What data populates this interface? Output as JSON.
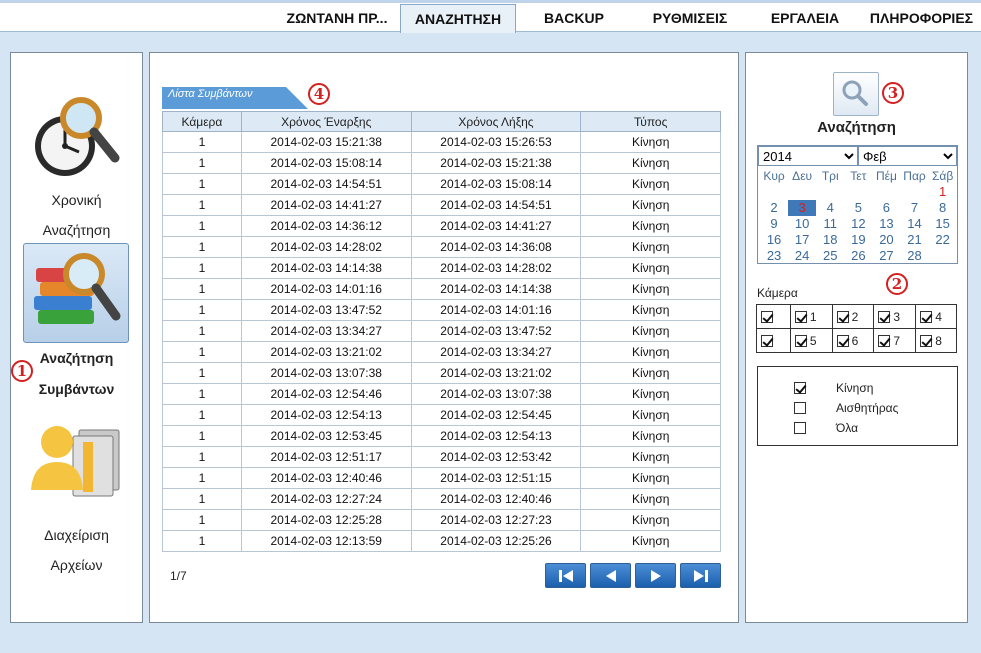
{
  "nav": {
    "tabs": [
      {
        "label": "ΖΩΝΤΑΝΗ ΠΡ...",
        "active": false
      },
      {
        "label": "ΑΝΑΖΗΤΗΣΗ",
        "active": true
      },
      {
        "label": "BACKUP",
        "active": false
      },
      {
        "label": "ΡΥΘΜΙΣΕΙΣ",
        "active": false
      },
      {
        "label": "ΕΡΓΑΛΕΙΑ",
        "active": false
      },
      {
        "label": "ΠΛΗΡΟΦΟΡΙΕΣ",
        "active": false
      }
    ]
  },
  "sidebar": {
    "items": [
      {
        "line1": "Χρονική",
        "line2": "Αναζήτηση",
        "icon": "clock-search-icon",
        "selected": false
      },
      {
        "line1": "Αναζήτηση",
        "line2": "Συμβάντων",
        "icon": "books-search-icon",
        "selected": true
      },
      {
        "line1": "Διαχείριση",
        "line2": "Αρχείων",
        "icon": "user-files-icon",
        "selected": false
      }
    ]
  },
  "markers": [
    "1",
    "2",
    "3",
    "4"
  ],
  "events": {
    "tab_label": "Λίστα Συμβάντων",
    "columns": [
      "Κάμερα",
      "Χρόνος Έναρξης",
      "Χρόνος Λήξης",
      "Τύπος"
    ],
    "rows": [
      [
        "1",
        "2014-02-03 15:21:38",
        "2014-02-03 15:26:53",
        "Κίνηση"
      ],
      [
        "1",
        "2014-02-03 15:08:14",
        "2014-02-03 15:21:38",
        "Κίνηση"
      ],
      [
        "1",
        "2014-02-03 14:54:51",
        "2014-02-03 15:08:14",
        "Κίνηση"
      ],
      [
        "1",
        "2014-02-03 14:41:27",
        "2014-02-03 14:54:51",
        "Κίνηση"
      ],
      [
        "1",
        "2014-02-03 14:36:12",
        "2014-02-03 14:41:27",
        "Κίνηση"
      ],
      [
        "1",
        "2014-02-03 14:28:02",
        "2014-02-03 14:36:08",
        "Κίνηση"
      ],
      [
        "1",
        "2014-02-03 14:14:38",
        "2014-02-03 14:28:02",
        "Κίνηση"
      ],
      [
        "1",
        "2014-02-03 14:01:16",
        "2014-02-03 14:14:38",
        "Κίνηση"
      ],
      [
        "1",
        "2014-02-03 13:47:52",
        "2014-02-03 14:01:16",
        "Κίνηση"
      ],
      [
        "1",
        "2014-02-03 13:34:27",
        "2014-02-03 13:47:52",
        "Κίνηση"
      ],
      [
        "1",
        "2014-02-03 13:21:02",
        "2014-02-03 13:34:27",
        "Κίνηση"
      ],
      [
        "1",
        "2014-02-03 13:07:38",
        "2014-02-03 13:21:02",
        "Κίνηση"
      ],
      [
        "1",
        "2014-02-03 12:54:46",
        "2014-02-03 13:07:38",
        "Κίνηση"
      ],
      [
        "1",
        "2014-02-03 12:54:13",
        "2014-02-03 12:54:45",
        "Κίνηση"
      ],
      [
        "1",
        "2014-02-03 12:53:45",
        "2014-02-03 12:54:13",
        "Κίνηση"
      ],
      [
        "1",
        "2014-02-03 12:51:17",
        "2014-02-03 12:53:42",
        "Κίνηση"
      ],
      [
        "1",
        "2014-02-03 12:40:46",
        "2014-02-03 12:51:15",
        "Κίνηση"
      ],
      [
        "1",
        "2014-02-03 12:27:24",
        "2014-02-03 12:40:46",
        "Κίνηση"
      ],
      [
        "1",
        "2014-02-03 12:25:28",
        "2014-02-03 12:27:23",
        "Κίνηση"
      ],
      [
        "1",
        "2014-02-03 12:13:59",
        "2014-02-03 12:25:26",
        "Κίνηση"
      ]
    ],
    "page_info": "1/7"
  },
  "search": {
    "title": "Αναζήτηση",
    "year": "2014",
    "month": "Φεβ",
    "weekdays": [
      "Κυρ",
      "Δευ",
      "Τρι",
      "Τετ",
      "Πέμ",
      "Παρ",
      "Σάβ"
    ],
    "weeks": [
      [
        "",
        "",
        "",
        "",
        "",
        "",
        "1"
      ],
      [
        "2",
        "3",
        "4",
        "5",
        "6",
        "7",
        "8"
      ],
      [
        "9",
        "10",
        "11",
        "12",
        "13",
        "14",
        "15"
      ],
      [
        "16",
        "17",
        "18",
        "19",
        "20",
        "21",
        "22"
      ],
      [
        "23",
        "24",
        "25",
        "26",
        "27",
        "28",
        ""
      ]
    ],
    "selected_day": "3",
    "recorded_days": [
      "1",
      "3"
    ],
    "camera_label": "Κάμερα",
    "camera_rows": [
      {
        "all": true,
        "cams": [
          {
            "label": "1",
            "checked": true
          },
          {
            "label": "2",
            "checked": true
          },
          {
            "label": "3",
            "checked": true
          },
          {
            "label": "4",
            "checked": true
          }
        ]
      },
      {
        "all": true,
        "cams": [
          {
            "label": "5",
            "checked": true
          },
          {
            "label": "6",
            "checked": true
          },
          {
            "label": "7",
            "checked": true
          },
          {
            "label": "8",
            "checked": true
          }
        ]
      }
    ],
    "types": [
      {
        "label": "Κίνηση",
        "checked": true
      },
      {
        "label": "Αισθητήρας",
        "checked": false
      },
      {
        "label": "Όλα",
        "checked": false
      }
    ]
  },
  "colors": {
    "accent": "#1c5fae",
    "marker": "#d42020",
    "calendar_day": "#3a6a9a"
  }
}
